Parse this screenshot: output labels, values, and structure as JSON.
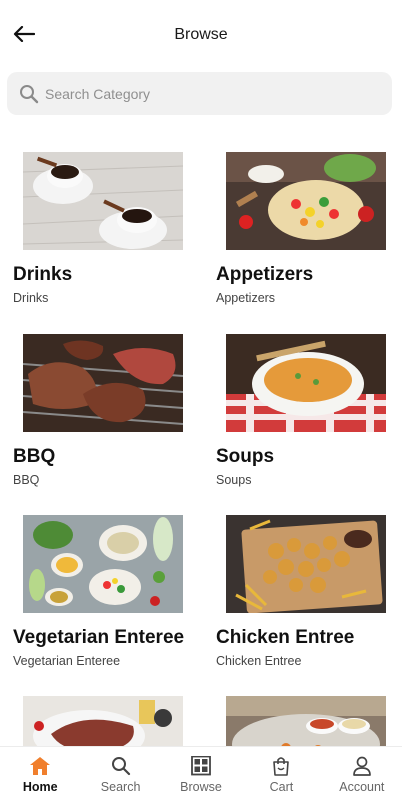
{
  "header": {
    "title": "Browse",
    "back_icon": "arrow-left-icon"
  },
  "search": {
    "placeholder": "Search Category",
    "icon": "search-icon"
  },
  "categories": [
    {
      "title": "Drinks",
      "subtitle": "Drinks",
      "image": "coffee-cups-photo"
    },
    {
      "title": "Appetizers",
      "subtitle": "Appetizers",
      "image": "tortilla-wrap-photo"
    },
    {
      "title": "BBQ",
      "subtitle": "BBQ",
      "image": "grilled-meat-photo"
    },
    {
      "title": "Soups",
      "subtitle": "Soups",
      "image": "soup-bowl-photo"
    },
    {
      "title": "Vegetarian Enteree",
      "subtitle": "Vegetarian Enteree",
      "image": "vegetable-spread-photo"
    },
    {
      "title": "Chicken Entree",
      "subtitle": "Chicken Entree",
      "image": "fried-chicken-photo"
    },
    {
      "title": "",
      "subtitle": "",
      "image": "steak-photo"
    },
    {
      "title": "",
      "subtitle": "",
      "image": "sauce-dishes-photo"
    }
  ],
  "tabs": [
    {
      "label": "Home",
      "icon": "home-icon",
      "active": true
    },
    {
      "label": "Search",
      "icon": "search-icon",
      "active": false
    },
    {
      "label": "Browse",
      "icon": "grid-icon",
      "active": false
    },
    {
      "label": "Cart",
      "icon": "shopping-bag-icon",
      "active": false
    },
    {
      "label": "Account",
      "icon": "user-icon",
      "active": false
    }
  ],
  "colors": {
    "accent": "#F07F2D",
    "search_bg": "#F1F1F1",
    "text": "#111111",
    "muted": "#444444"
  }
}
